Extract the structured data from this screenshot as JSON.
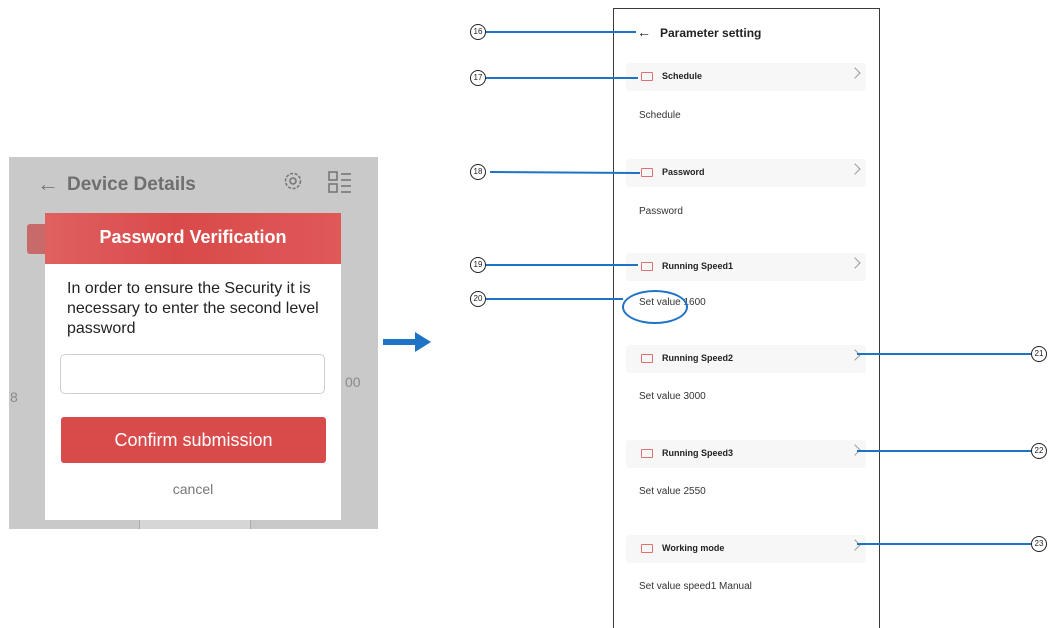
{
  "left_screen": {
    "back_icon": "←",
    "title": "Device Details",
    "side_value_left": "8",
    "side_value_right": "00",
    "dialog": {
      "title": "Password Verification",
      "message": "In order to ensure the Security it is necessary to enter the second level password",
      "input_value": "",
      "input_placeholder": "",
      "confirm_label": "Confirm submission",
      "cancel_label": "cancel",
      "accent_color": "#d94b4b"
    }
  },
  "arrow_color": "#1f73c7",
  "right_screen": {
    "back_icon": "←",
    "title": "Parameter setting",
    "rows": [
      {
        "label": "Schedule",
        "value": "Schedule"
      },
      {
        "label": "Password",
        "value": "Password"
      },
      {
        "label": "Running Speed1",
        "value": "Set value 1600"
      },
      {
        "label": "Running Speed2",
        "value": "Set value 3000"
      },
      {
        "label": "Running Speed3",
        "value": "Set value 2550"
      },
      {
        "label": "Working mode",
        "value": "Set value speed1 Manual"
      }
    ]
  },
  "callouts": {
    "c16": "16",
    "c17": "17",
    "c18": "18",
    "c19": "19",
    "c20": "20",
    "c21": "21",
    "c22": "22",
    "c23": "23"
  }
}
